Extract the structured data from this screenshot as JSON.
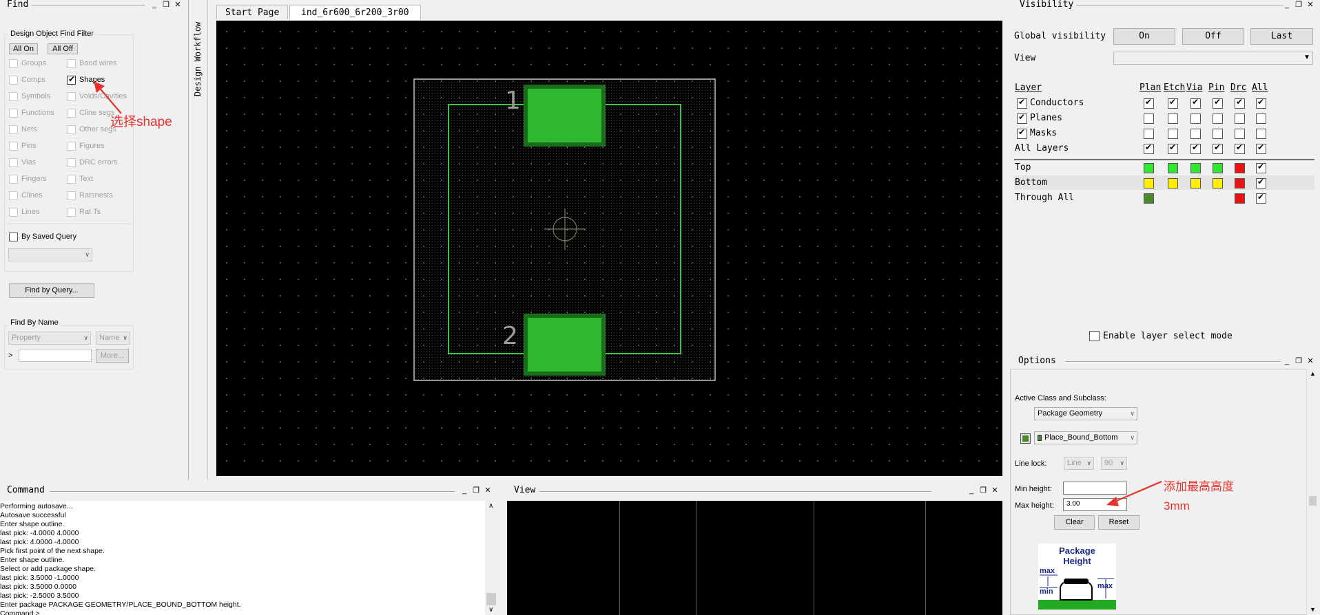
{
  "find": {
    "title": "Find",
    "filter_group": "Design Object Find Filter",
    "all_on": "All On",
    "all_off": "All Off",
    "left_items": [
      "Groups",
      "Comps",
      "Symbols",
      "Functions",
      "Nets",
      "Pins",
      "Vias",
      "Fingers",
      "Clines",
      "Lines"
    ],
    "right_items": [
      "Bond wires",
      "Shapes",
      "Voids/Cavities",
      "Cline segs",
      "Other segs",
      "Figures",
      "DRC errors",
      "Text",
      "Ratsnests",
      "Rat Ts"
    ],
    "shapes_checked": true,
    "by_saved_query": "By Saved Query",
    "find_by_query": "Find by Query...",
    "find_by_name": "Find By Name",
    "property": "Property",
    "name_combo": "Name",
    "name_arrow": ">",
    "more": "More..."
  },
  "annotations": {
    "select_shape": "选择shape",
    "add_max_height_1": "添加最高高度",
    "add_max_height_2": "3mm"
  },
  "side_tab": "Design Workflow",
  "tabs": [
    "Start Page",
    "ind_6r600_6r200_3r00"
  ],
  "canvas": {
    "pad1_label": "1",
    "pad2_label": "2"
  },
  "visibility": {
    "title": "Visibility",
    "global_label": "Global visibility",
    "on": "On",
    "off": "Off",
    "last": "Last",
    "view_label": "View",
    "view_value": "",
    "col_layer": "Layer",
    "cols": [
      "Plan",
      "Etch",
      "Via",
      "Pin",
      "Drc",
      "All"
    ],
    "layers": [
      {
        "name": "Conductors",
        "checked": true,
        "cells": [
          1,
          1,
          1,
          1,
          1,
          1
        ]
      },
      {
        "name": "Planes",
        "checked": true,
        "cells": [
          0,
          0,
          0,
          0,
          0,
          0
        ]
      },
      {
        "name": "Masks",
        "checked": true,
        "cells": [
          0,
          0,
          0,
          0,
          0,
          0
        ]
      },
      {
        "name": "All Layers",
        "checked": null,
        "cells": [
          1,
          1,
          1,
          1,
          1,
          1
        ]
      }
    ],
    "sub_layers": [
      {
        "name": "Top",
        "colors": [
          "#33e633",
          "#33e633",
          "#33e633",
          "#33e633",
          "#ee1111"
        ],
        "all": true
      },
      {
        "name": "Bottom",
        "colors": [
          "#ffee00",
          "#ffee00",
          "#ffee00",
          "#ffee00",
          "#ee1111"
        ],
        "all": true
      },
      {
        "name": "Through All",
        "colors": [
          "#4a8a2a",
          null,
          null,
          null,
          "#ee1111"
        ],
        "all": true
      }
    ],
    "enable_layer_select": "Enable layer select mode"
  },
  "options": {
    "title": "Options",
    "active_class_label": "Active Class and Subclass:",
    "class_value": "Package Geometry",
    "subclass_value": "Place_Bound_Bottom",
    "line_lock": "Line lock:",
    "line_lock_type": "Line",
    "line_lock_angle": "90",
    "min_height_label": "Min height:",
    "min_height_value": "",
    "max_height_label": "Max height:",
    "max_height_value": "3.00",
    "clear": "Clear",
    "reset": "Reset",
    "pkg_height_1": "Package",
    "pkg_height_2": "Height",
    "max": "max",
    "min": "min"
  },
  "command": {
    "title": "Command",
    "lines": [
      "Performing autosave...",
      "Autosave successful",
      "Enter shape outline.",
      "last pick:  -4.0000 4.0000",
      "last pick:  4.0000 -4.0000",
      "Pick first point of the next shape.",
      "Enter shape outline.",
      "Select or add package shape.",
      "last pick:  3.5000 -1.0000",
      "last pick:  3.5000 0.0000",
      "last pick:  -2.5000 3.5000",
      "Enter package PACKAGE GEOMETRY/PLACE_BOUND_BOTTOM height.",
      "Command >"
    ]
  },
  "view": {
    "title": "View"
  },
  "colors": {
    "canvas": "#000000",
    "pad": "#2db82d",
    "outline": "#3cc83c",
    "annotation": "#e8322c"
  }
}
